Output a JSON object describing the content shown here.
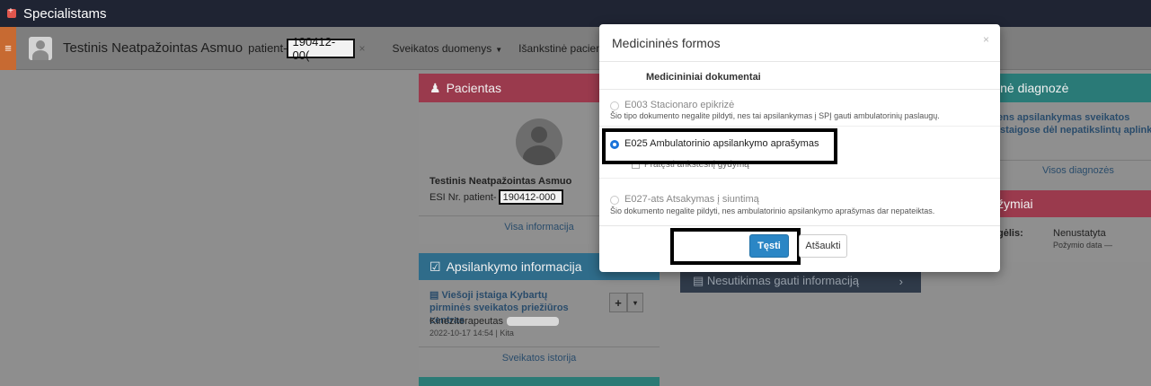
{
  "app": {
    "title": "Specialistams"
  },
  "patient_bar": {
    "name": "Testinis Neatpažointas Asmuo",
    "id_label": "patient-",
    "id_value": "190412-00(",
    "close_glyph": "×",
    "nav": [
      {
        "label": "Sveikatos duomenys"
      },
      {
        "label": "Išankstinė pacientų registracija"
      }
    ]
  },
  "pacientas": {
    "header": "Pacientas",
    "name": "Testinis Neatpažointas Asmuo",
    "esi_label": "ESI Nr. patient-",
    "esi_value": "190412-000",
    "link": "Visa informacija"
  },
  "apsilankymas": {
    "header": "Apsilankymo informacija",
    "org": "Viešoji įstaiga Kybartų pirminės sveikatos priežiūros centras",
    "role": "Kineziterapeutas",
    "meta": "2022-10-17 14:54  |  Kita",
    "add_btn": "+",
    "menu_btn": "▾",
    "link": "Sveikatos istorija"
  },
  "nesutikimas": {
    "label": "Nesutikimas gauti informaciją",
    "arrow": "›"
  },
  "diagnoze": {
    "header": "inė diagnozė",
    "lines": [
      "ens apsilankymas sveikatos",
      "įstaigose dėl nepatikslintų aplinky",
      ""
    ],
    "link": "Visos diagnozės"
  },
  "pozymiai": {
    "header": "žymiai",
    "label": "gėlis:",
    "value": "Nenustatyta",
    "date": "Požymio data —"
  },
  "modal": {
    "title": "Medicininės formos",
    "close": "×",
    "section": "Medicininiai dokumentai",
    "options": [
      {
        "title": "E003 Stacionaro epikrizė",
        "note": "Šio tipo dokumento negalite pildyti, nes tai apsilankymas į SPĮ gauti ambulatorinių paslaugų.",
        "selected": false
      },
      {
        "title": "E025 Ambulatorinio apsilankymo aprašymas",
        "note": "",
        "selected": true
      },
      {
        "title": "E027-ats Atsakymas į siuntimą",
        "note": "Šio dokumento negalite pildyti, nes ambulatorinio apsilankymo aprašymas dar nepateiktas.",
        "selected": false
      }
    ],
    "checkbox_label": "Pratęsti ankstesnį gydymą",
    "continue_btn": "Tęsti",
    "cancel_btn": "Atšaukti"
  },
  "colors": {
    "accent": "#2b86c5",
    "radio_selected": "#1a73d9"
  }
}
